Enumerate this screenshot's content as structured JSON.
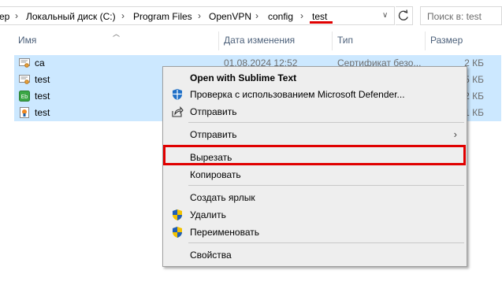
{
  "address_bar": {
    "crumbs": [
      "ер",
      "Локальный диск (C:)",
      "Program Files",
      "OpenVPN",
      "config",
      "test"
    ],
    "search_placeholder": "Поиск в: test"
  },
  "columns": {
    "name": "Имя",
    "date": "Дата изменения",
    "type": "Тип",
    "size": "Размер"
  },
  "files": [
    {
      "name": "ca",
      "date": "01.08.2024 12:52",
      "type": "Сертификат безо...",
      "size": "2 КБ",
      "icon": "certificate-icon"
    },
    {
      "name": "test",
      "date": "",
      "type": "",
      "size": "5 КБ",
      "icon": "certificate-icon"
    },
    {
      "name": "test",
      "date": "",
      "type": "",
      "size": "2 КБ",
      "icon": "key-file-icon"
    },
    {
      "name": "test",
      "date": "",
      "type": "",
      "size": "1 КБ",
      "icon": "openvpn-config-icon"
    }
  ],
  "context_menu": {
    "open_with": "Open with Sublime Text",
    "defender": "Проверка с использованием Microsoft Defender...",
    "share": "Отправить",
    "send_to": "Отправить",
    "cut": "Вырезать",
    "copy": "Копировать",
    "create_shortcut": "Создать ярлык",
    "delete": "Удалить",
    "rename": "Переименовать",
    "properties": "Свойства"
  },
  "colors": {
    "selection": "#cce8ff",
    "menu_bg": "#eeeeee",
    "highlight_red": "#e00000",
    "header_text": "#4c607a"
  }
}
